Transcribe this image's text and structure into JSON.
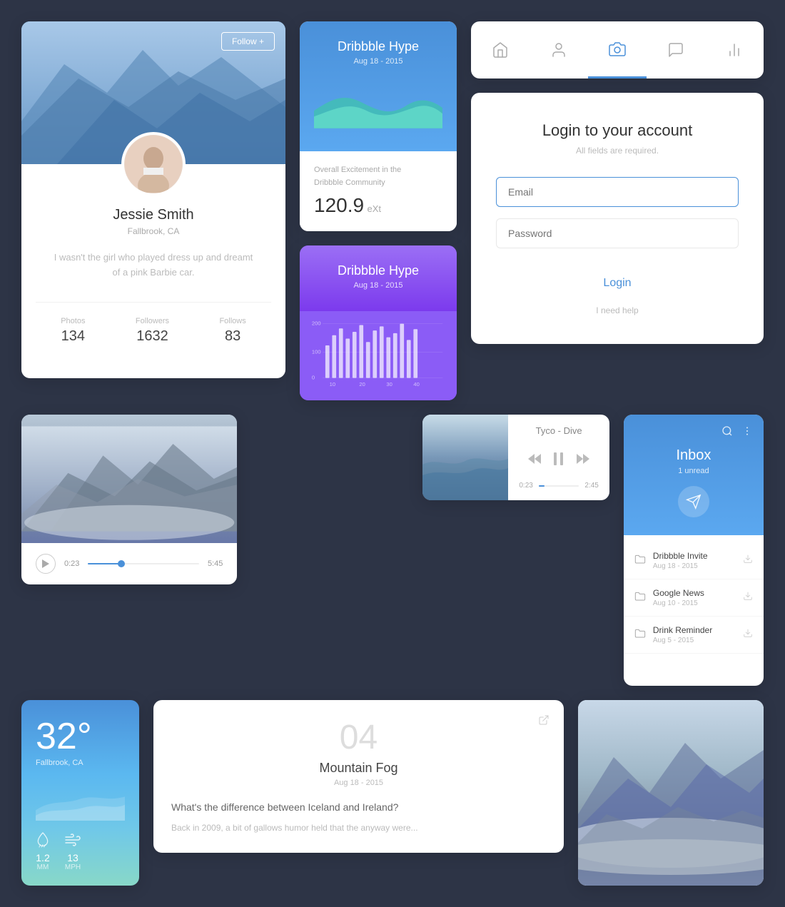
{
  "bg": "#2d3446",
  "profile": {
    "follow_btn": "Follow +",
    "name": "Jessie Smith",
    "location": "Fallbrook, CA",
    "bio": "I wasn't the girl who played dress up and dreamt of a pink Barbie car.",
    "stats": {
      "photos_label": "Photos",
      "photos_value": "134",
      "followers_label": "Followers",
      "followers_value": "1632",
      "follows_label": "Follows",
      "follows_value": "83"
    }
  },
  "hype1": {
    "title": "Dribbble Hype",
    "date": "Aug 18 - 2015",
    "label": "Overall Excitement in the",
    "label2": "Dribbble Community",
    "value": "120.9",
    "unit": "eXt"
  },
  "hype2": {
    "title": "Dribbble Hype",
    "date": "Aug 18 - 2015",
    "y_labels": [
      "200",
      "100",
      "0"
    ],
    "x_labels": [
      "10",
      "20",
      "30",
      "40"
    ]
  },
  "nav": {
    "items": [
      {
        "icon": "home-icon",
        "active": false
      },
      {
        "icon": "person-icon",
        "active": false
      },
      {
        "icon": "camera-icon",
        "active": true
      },
      {
        "icon": "chat-icon",
        "active": false
      },
      {
        "icon": "chart-icon",
        "active": false
      }
    ]
  },
  "login": {
    "title": "Login to your account",
    "subtitle": "All fields are required.",
    "email_placeholder": "Email",
    "password_placeholder": "Password",
    "login_btn": "Login",
    "help_text": "I need help"
  },
  "video": {
    "time_current": "0:23",
    "time_total": "5:45",
    "progress_pct": 30
  },
  "music": {
    "title": "Tyco - Dive",
    "time_current": "0:23",
    "time_total": "2:45"
  },
  "inbox": {
    "title": "Inbox",
    "unread": "1 unread",
    "items": [
      {
        "name": "Dribbble Invite",
        "date": "Aug 18 - 2015"
      },
      {
        "name": "Google News",
        "date": "Aug 10 - 2015"
      },
      {
        "name": "Drink Reminder",
        "date": "Aug 5 - 2015"
      }
    ]
  },
  "weather": {
    "temp": "32°",
    "city": "Fallbrook, CA",
    "rain_label": "MM",
    "rain_value": "1.2",
    "wind_label": "MPH",
    "wind_value": "13"
  },
  "blog": {
    "number": "04",
    "title": "Mountain Fog",
    "date": "Aug 18 - 2015",
    "question": "What's the difference between Iceland and Ireland?",
    "excerpt": "Back in 2009, a bit of gallows humor held that the anyway were..."
  }
}
